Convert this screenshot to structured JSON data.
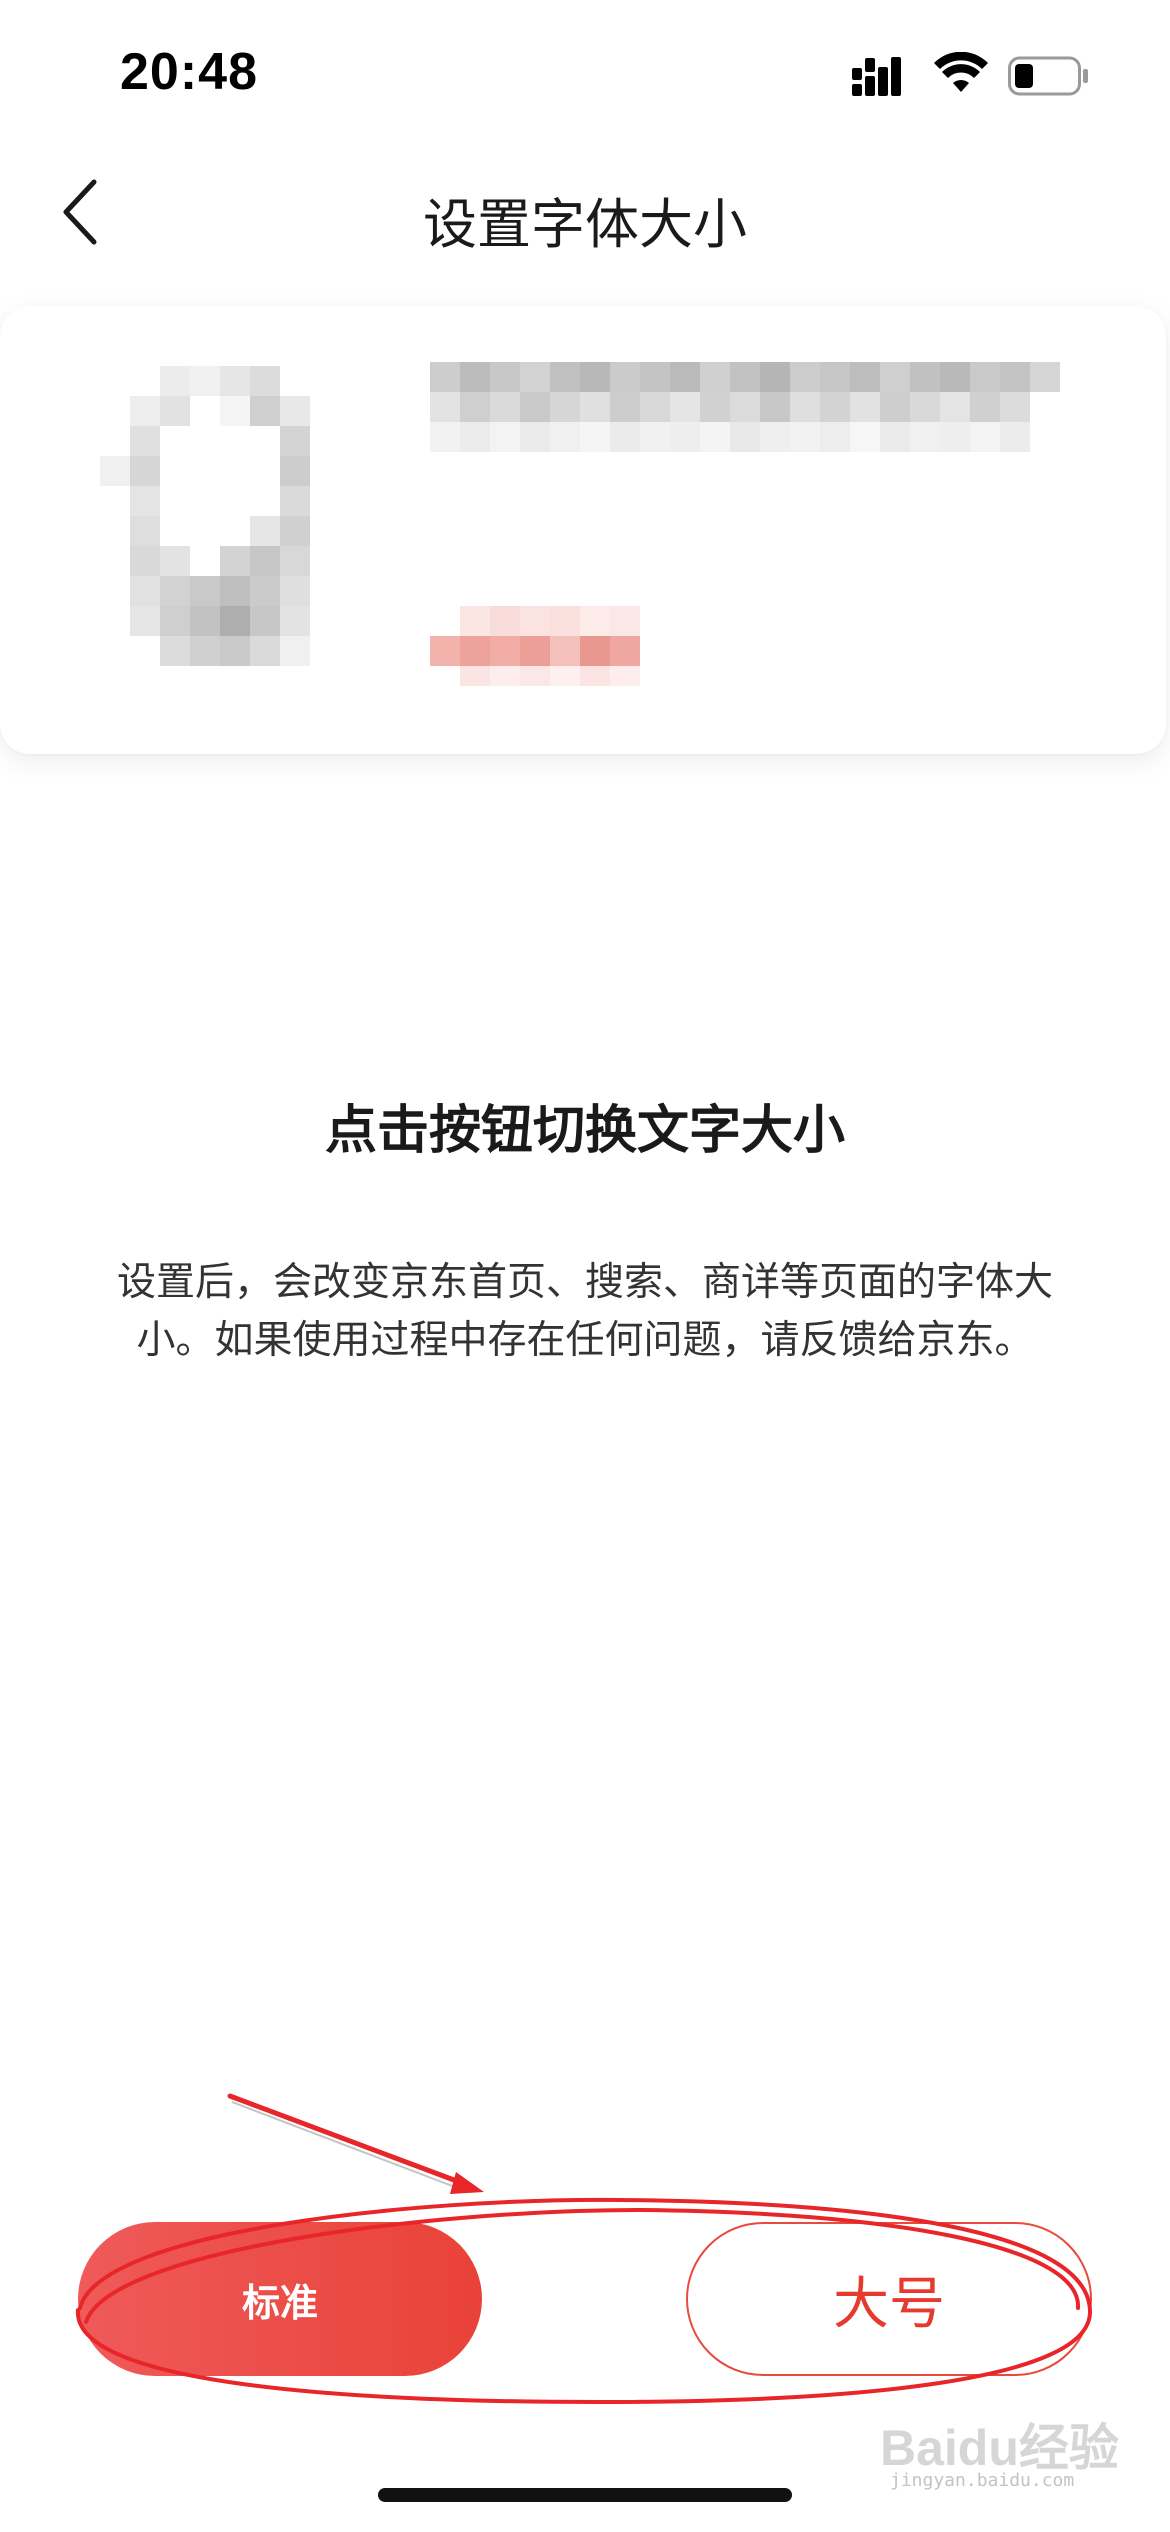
{
  "status_bar": {
    "time": "20:48",
    "icons": [
      "signal-icon",
      "wifi-icon",
      "battery-icon"
    ]
  },
  "nav": {
    "back_icon": "chevron-left-icon",
    "title": "设置字体大小"
  },
  "preview": {
    "image": "blurred-product-image",
    "title": "blurred-product-title",
    "price": "blurred-price",
    "price_color": "#e8736b"
  },
  "instructions": {
    "headline": "点击按钮切换文字大小",
    "description": "设置后，会改变京东首页、搜索、商详等页面的字体大小。如果使用过程中存在任何问题，请反馈给京东。"
  },
  "buttons": {
    "standard_label": "标准",
    "large_label": "大号",
    "selected": "standard",
    "accent_color": "#e94238"
  },
  "watermark": {
    "text": "Baidu经验",
    "sub": "jingyan.baidu.com"
  },
  "annotation_color": "#e8262a"
}
